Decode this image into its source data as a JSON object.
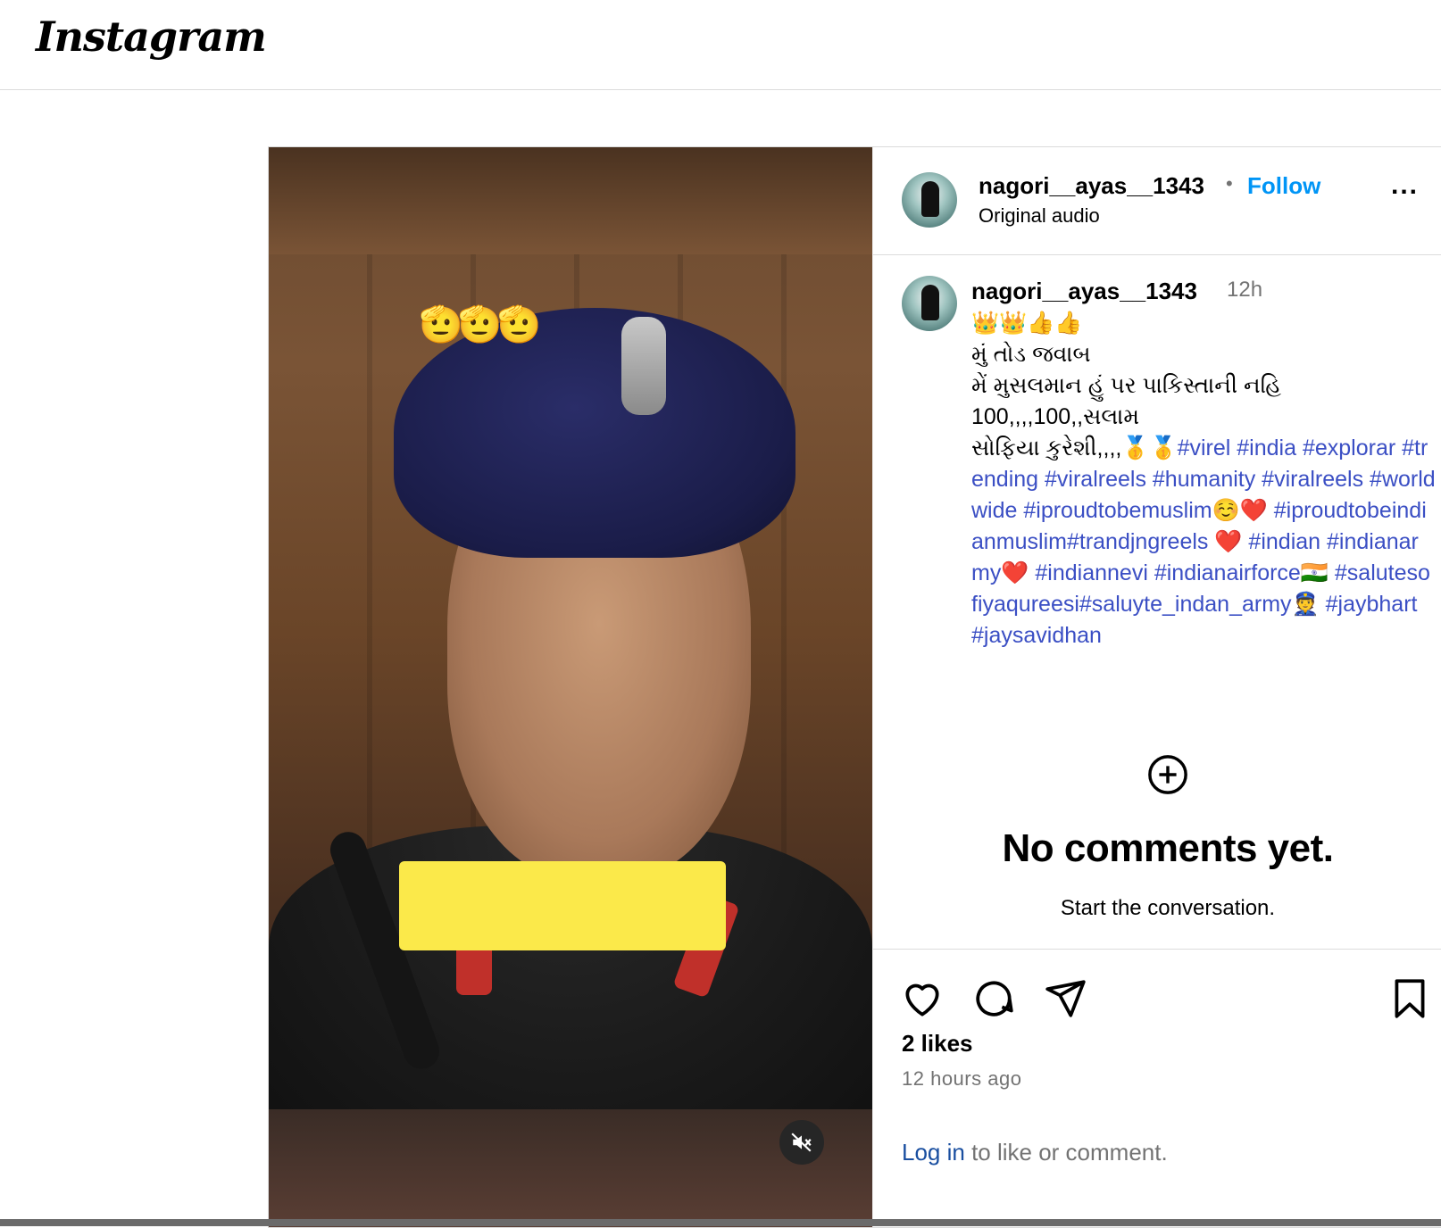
{
  "app": {
    "logo_text": "Instagram"
  },
  "post": {
    "media": {
      "overlay_emoji": "🫡🫡🫡",
      "mute_icon": "speaker-muted-icon"
    },
    "header": {
      "username": "nagori__ayas__1343",
      "separator": "•",
      "follow_label": "Follow",
      "subtitle": "Original audio",
      "more_icon": "more-options-icon",
      "more_label": "..."
    },
    "caption": {
      "username": "nagori__ayas__1343",
      "time": "12h",
      "text_plain": "👑👑👍👍\nમું તોડ જવાબ\nમેં મુસલમાન હું પર પાકિસ્તાની નહિ\n100,,,,100,,સલામ\nસોફિયા કુરેશી,,,,🥇🥇",
      "text_tags": "#virel #india #explorar #trending #viralreels #humanity #viralreels #worldwide #iproudtobemuslim☺️❤️ #iproudtobeindianmuslim#trandjngreels ❤️ #indian #indianarmy❤️ #indiannevi #indianairforce🇮🇳 #salutesofiyaqureesi#saluyte_indan_army👮 #jaybhart #jaysavidhan"
    },
    "comments": {
      "add_icon": "add-circle-icon",
      "empty_title": "No comments yet.",
      "empty_subtitle": "Start the conversation."
    },
    "actions": {
      "like_icon": "heart-icon",
      "comment_icon": "comment-icon",
      "share_icon": "share-icon",
      "save_icon": "bookmark-icon",
      "likes_text": "2 likes",
      "time_ago": "12 hours ago",
      "login_link": "Log in",
      "login_rest": " to like or comment."
    }
  },
  "colors": {
    "follow": "#0095f6",
    "hashtag": "#3b4fc4",
    "secondary_text": "#737373",
    "video_caption_box": "#fbe94a"
  }
}
